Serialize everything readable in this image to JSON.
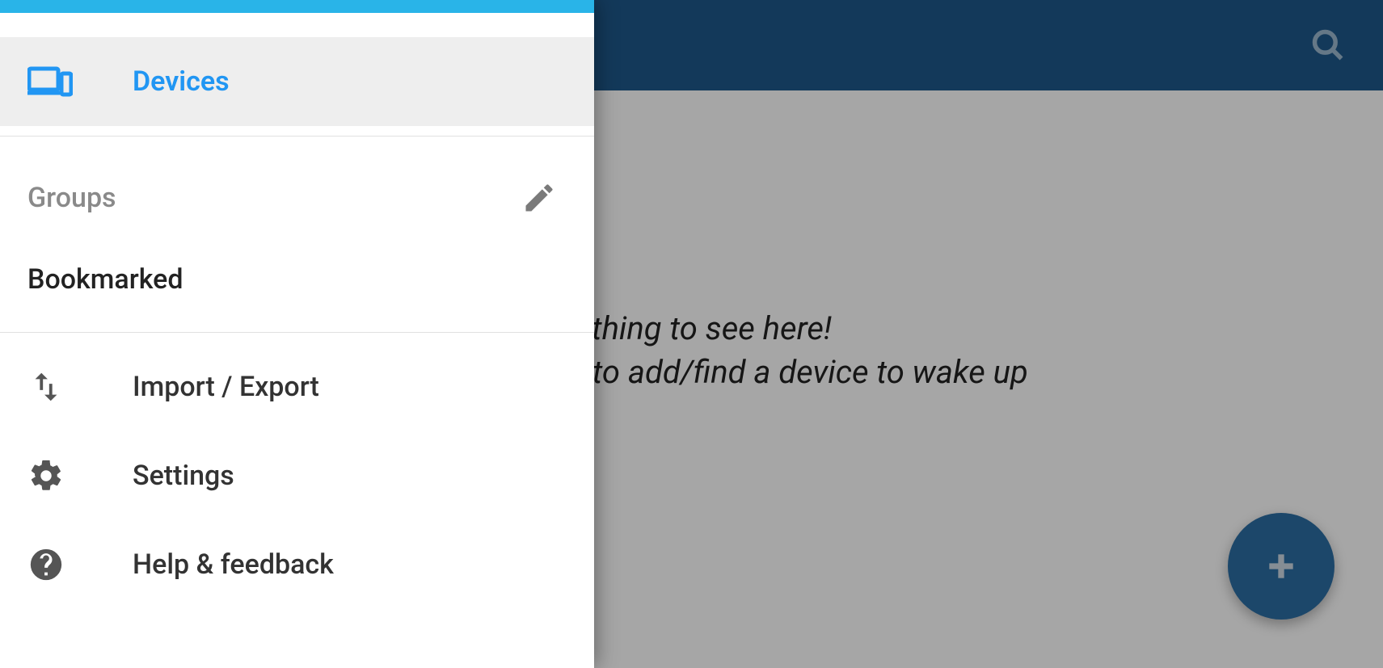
{
  "appbar": {},
  "empty": {
    "line1": "Nothing to see here!",
    "line2": "Use the + button to add/find a device to wake up"
  },
  "drawer": {
    "devices_label": "Devices",
    "groups_header": "Groups",
    "groups": {
      "bookmarked_label": "Bookmarked"
    },
    "menu": {
      "import_export": "Import / Export",
      "settings": "Settings",
      "help_feedback": "Help & feedback"
    }
  }
}
